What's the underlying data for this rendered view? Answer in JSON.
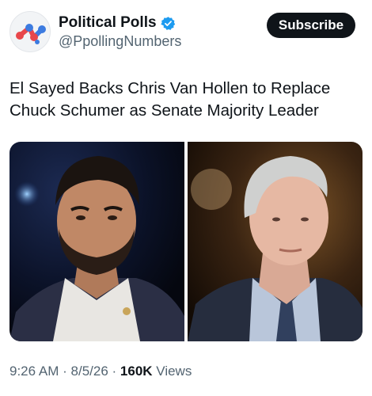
{
  "account": {
    "display_name": "Political Polls",
    "handle": "@PpollingNumbers",
    "verified": true,
    "avatar_icon": "political-polls-logo"
  },
  "actions": {
    "subscribe_label": "Subscribe"
  },
  "tweet": {
    "text": "El Sayed Backs Chris Van Hollen to Replace Chuck Schumer as Senate Majority Leader",
    "media": [
      {
        "kind": "photo",
        "subject": "man-dark-hair-beard"
      },
      {
        "kind": "photo",
        "subject": "man-gray-hair-suit"
      }
    ]
  },
  "meta": {
    "time": "9:26 AM",
    "separator": "·",
    "date": "8/5/26",
    "views_count": "160K",
    "views_label": "Views"
  },
  "colors": {
    "text_primary": "#0f1419",
    "text_secondary": "#536471",
    "verified_blue": "#1d9bf0",
    "button_bg": "#0f1419",
    "logo_red": "#e8474b",
    "logo_blue": "#3c7be0"
  }
}
